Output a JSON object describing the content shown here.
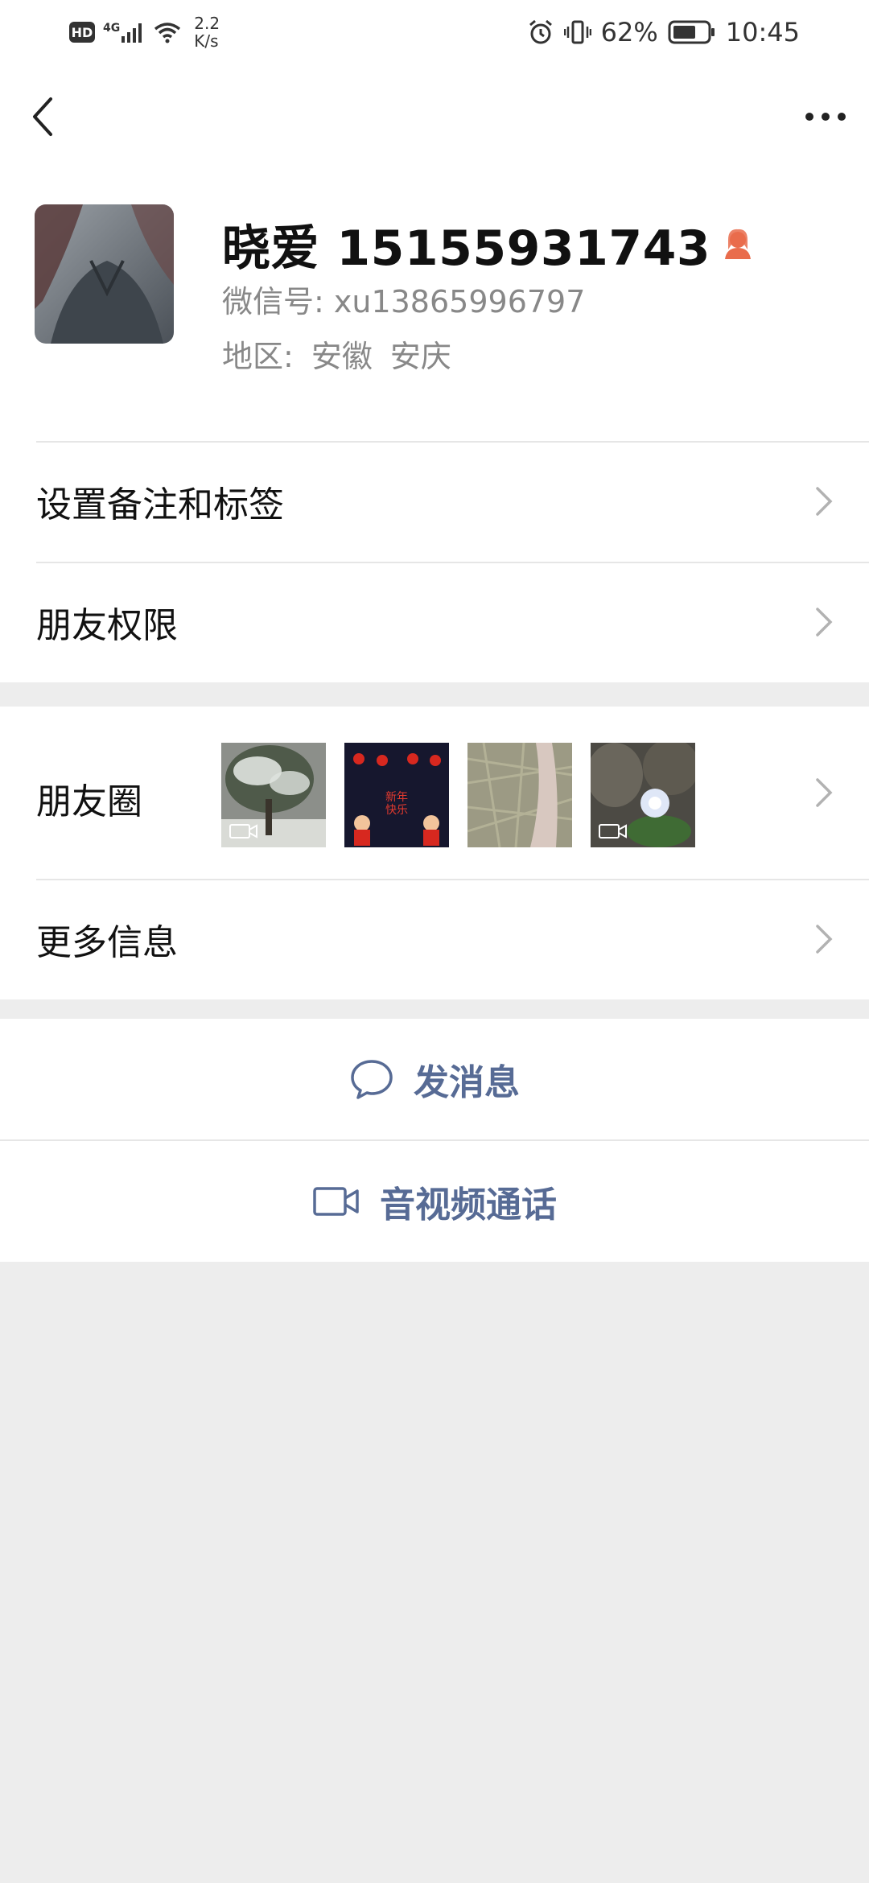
{
  "status_bar": {
    "hd": "HD",
    "signal": "4G",
    "net_speed_value": "2.2",
    "net_speed_unit": "K/s",
    "battery": "62%",
    "time": "10:45"
  },
  "nav": {
    "back_icon": "chevron-left-icon",
    "more_icon": "ellipsis-icon"
  },
  "profile": {
    "name": "晓爱 15155931743",
    "gender_icon": "female-icon",
    "wechat_id": "微信号: xu13865996797",
    "region_label": "地区:",
    "region_province": "安徽",
    "region_city": "安庆"
  },
  "menu": {
    "remark_tags": "设置备注和标签",
    "friend_permissions": "朋友权限",
    "moments": "朋友圈",
    "more_info": "更多信息"
  },
  "actions": {
    "send_message": "发消息",
    "video_call": "音视频通话"
  },
  "moment_thumbs": [
    {
      "label": "snow-tree-photo",
      "has_video": true
    },
    {
      "label": "新年快乐",
      "has_video": false
    },
    {
      "label": "grass-photo",
      "has_video": false
    },
    {
      "label": "rock-garden-photo",
      "has_video": true
    }
  ],
  "colors": {
    "link_blue": "#576b95",
    "background": "#ededed",
    "female_icon": "#e96c4c"
  }
}
